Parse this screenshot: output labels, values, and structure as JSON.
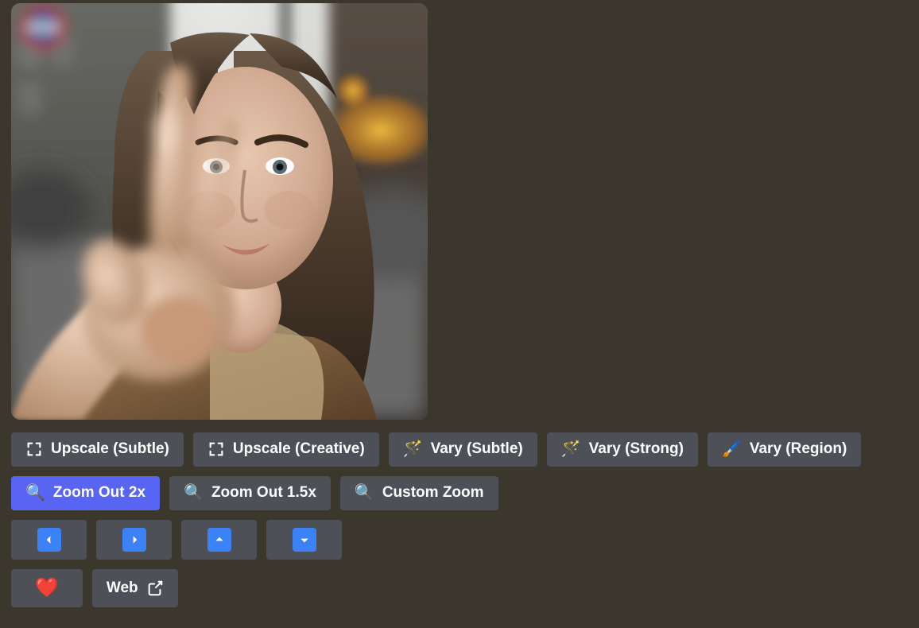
{
  "buttons": {
    "row1": {
      "upscale_subtle": "Upscale (Subtle)",
      "upscale_creative": "Upscale (Creative)",
      "vary_subtle": "Vary (Subtle)",
      "vary_strong": "Vary (Strong)",
      "vary_region": "Vary (Region)"
    },
    "row2": {
      "zoom_out_2x": "Zoom Out 2x",
      "zoom_out_15x": "Zoom Out 1.5x",
      "custom_zoom": "Custom Zoom"
    },
    "row4": {
      "web": "Web"
    }
  },
  "icons": {
    "expand": "expand",
    "wand": "🪄",
    "brush": "🖌️",
    "magnifier": "🔍",
    "heart": "❤️",
    "external": "external-link"
  }
}
